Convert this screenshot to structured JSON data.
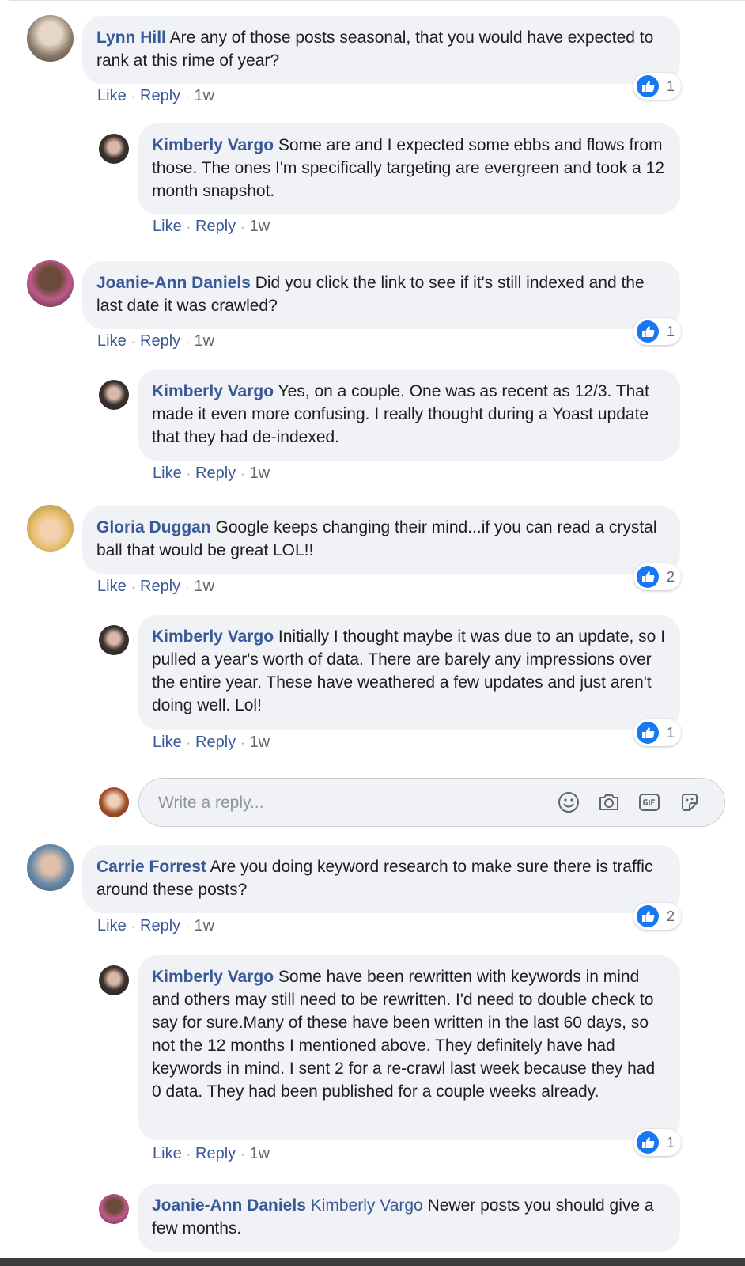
{
  "comments": [
    {
      "author": "Lynn Hill",
      "text": " Are any of those posts seasonal, that you would have expected to rank at this rime of year?",
      "actions": {
        "like": "Like",
        "reply": "Reply",
        "time": "1w"
      },
      "likes": "1",
      "avatar_color": "#8a7b6b"
    },
    {
      "author": "Kimberly Vargo",
      "text": " Some are and I expected some ebbs and flows from those. The ones I'm specifically targeting are evergreen and took a 12 month snapshot.",
      "actions": {
        "like": "Like",
        "reply": "Reply",
        "time": "1w"
      },
      "avatar_color": "#3b3330"
    },
    {
      "author": "Joanie-Ann Daniels",
      "text": " Did you click the link to see if it's still indexed and the last date it was crawled?",
      "actions": {
        "like": "Like",
        "reply": "Reply",
        "time": "1w"
      },
      "likes": "1",
      "avatar_color": "#5a3a4a"
    },
    {
      "author": "Kimberly Vargo",
      "text": " Yes, on a couple. One was as recent as 12/3. That made it even more confusing. I really thought during a Yoast update that they had de-indexed.",
      "actions": {
        "like": "Like",
        "reply": "Reply",
        "time": "1w"
      },
      "avatar_color": "#3b3330"
    },
    {
      "author": "Gloria Duggan",
      "text": " Google keeps changing their mind...if you can read a crystal ball that would be great LOL!!",
      "actions": {
        "like": "Like",
        "reply": "Reply",
        "time": "1w"
      },
      "likes": "2",
      "avatar_color": "#d8b35a"
    },
    {
      "author": "Kimberly Vargo",
      "text": " Initially I thought maybe it was due to an update, so I pulled a year's worth of data. There are barely any impressions over the entire year. These have weathered a few updates and just aren't doing well. Lol!",
      "actions": {
        "like": "Like",
        "reply": "Reply",
        "time": "1w"
      },
      "likes": "1",
      "avatar_color": "#3b3330"
    },
    {
      "author": "Carrie Forrest",
      "text": " Are you doing keyword research to make sure there is traffic around these posts?",
      "actions": {
        "like": "Like",
        "reply": "Reply",
        "time": "1w"
      },
      "likes": "2",
      "avatar_color": "#6a8aa8"
    },
    {
      "author": "Kimberly Vargo",
      "text": " Some have been rewritten with keywords in mind and others may still need to be rewritten. I'd need to double check to say for sure.Many of these have been written in the last 60 days, so not the 12 months I mentioned above. They definitely have had keywords in mind. I sent 2 for a re-crawl last week because they had 0 data. They had been published for a couple weeks already.",
      "actions": {
        "like": "Like",
        "reply": "Reply",
        "time": "1w"
      },
      "likes": "1",
      "avatar_color": "#3b3330"
    },
    {
      "author": "Joanie-Ann Daniels",
      "mention": "Kimberly Vargo",
      "text": " Newer posts you should give a few months.",
      "avatar_color": "#5a3a4a"
    }
  ],
  "reply_box": {
    "placeholder": "Write a reply...",
    "icons": [
      "emoji-icon",
      "camera-icon",
      "gif-icon",
      "sticker-icon"
    ]
  },
  "colors": {
    "link": "#385898",
    "bubble": "#f0f2f5",
    "like_blue": "#1877f2"
  }
}
